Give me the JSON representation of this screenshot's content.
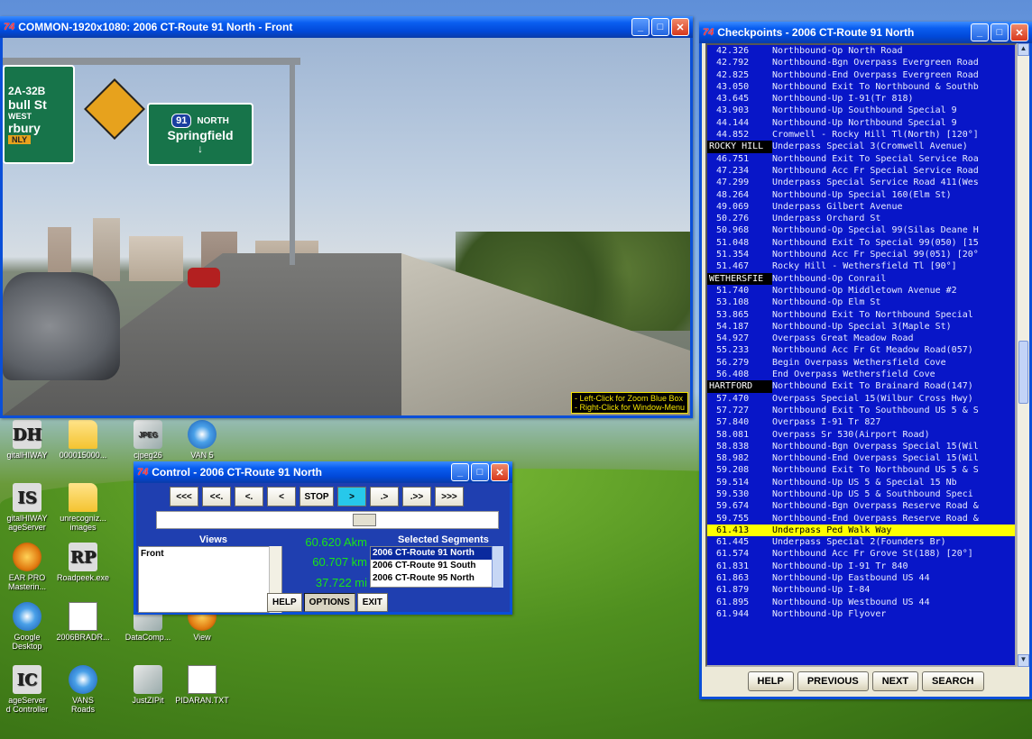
{
  "video_window": {
    "title": "COMMON-1920x1080: 2006 CT-Route 91 North - Front",
    "app_icon": "74",
    "signs": {
      "left_top": "2A-32B",
      "left_line1": "bull St",
      "left_line2": "WEST",
      "left_line3": "rbury",
      "left_line4": "NLY",
      "shield": "91",
      "direction": "NORTH",
      "city": "Springfield"
    },
    "hint_line1": "- Left-Click for Zoom Blue Box",
    "hint_line2": "- Right-Click for Window-Menu"
  },
  "checkpoints_window": {
    "title": "Checkpoints - 2006 CT-Route 91 North",
    "app_icon": "74",
    "rows": [
      {
        "km": "42.326",
        "desc": "Northbound-Op North Road"
      },
      {
        "km": "42.792",
        "desc": "Northbound-Bgn Overpass Evergreen Road"
      },
      {
        "km": "42.825",
        "desc": "Northbound-End Overpass Evergreen Road"
      },
      {
        "km": "43.050",
        "desc": "Northbound Exit To Northbound & Southb"
      },
      {
        "km": "43.645",
        "desc": "Northbound-Up I-91(Tr 818)"
      },
      {
        "km": "43.903",
        "desc": "Northbound-Up Southbound Special 9"
      },
      {
        "km": "44.144",
        "desc": "Northbound-Up Northbound Special 9"
      },
      {
        "km": "44.852",
        "desc": "Cromwell - Rocky Hill Tl(North) [120°]"
      },
      {
        "km": "ROCKY HILL",
        "desc": "Underpass Special 3(Cromwell Avenue)",
        "town": true
      },
      {
        "km": "46.751",
        "desc": "Northbound Exit To Special Service Roa"
      },
      {
        "km": "47.234",
        "desc": "Northbound Acc Fr Special Service Road"
      },
      {
        "km": "47.299",
        "desc": "Underpass Special Service Road 411(Wes"
      },
      {
        "km": "48.264",
        "desc": "Northbound-Up Special 160(Elm St)"
      },
      {
        "km": "49.069",
        "desc": "Underpass Gilbert Avenue"
      },
      {
        "km": "50.276",
        "desc": "Underpass Orchard St"
      },
      {
        "km": "50.968",
        "desc": "Northbound-Op Special 99(Silas Deane H"
      },
      {
        "km": "51.048",
        "desc": "Northbound Exit To Special 99(050) [15"
      },
      {
        "km": "51.354",
        "desc": "Northbound Acc Fr Special 99(051) [20°"
      },
      {
        "km": "51.467",
        "desc": "Rocky Hill - Wethersfield Tl [90°]"
      },
      {
        "km": "WETHERSFIE",
        "desc": "Northbound-Op Conrail",
        "town": true
      },
      {
        "km": "51.740",
        "desc": "Northbound-Op Middletown Avenue #2"
      },
      {
        "km": "53.108",
        "desc": "Northbound-Op Elm St"
      },
      {
        "km": "53.865",
        "desc": "Northbound Exit To Northbound Special"
      },
      {
        "km": "54.187",
        "desc": "Northbound-Up Special 3(Maple St)"
      },
      {
        "km": "54.927",
        "desc": "Overpass Great Meadow Road"
      },
      {
        "km": "55.233",
        "desc": "Northbound Acc Fr Gt Meadow Road(057)"
      },
      {
        "km": "56.279",
        "desc": "Begin Overpass Wethersfield Cove"
      },
      {
        "km": "56.408",
        "desc": "End Overpass Wethersfield Cove"
      },
      {
        "km": "HARTFORD",
        "desc": "Northbound Exit To Brainard Road(147)",
        "town": true
      },
      {
        "km": "57.470",
        "desc": "Overpass Special 15(Wilbur Cross Hwy)"
      },
      {
        "km": "57.727",
        "desc": "Northbound Exit To Southbound US 5 & S"
      },
      {
        "km": "57.840",
        "desc": "Overpass I-91 Tr 827"
      },
      {
        "km": "58.081",
        "desc": "Overpass Sr 530(Airport Road)"
      },
      {
        "km": "58.838",
        "desc": "Northbound-Bgn Overpass Special 15(Wil"
      },
      {
        "km": "58.982",
        "desc": "Northbound-End Overpass Special 15(Wil"
      },
      {
        "km": "59.208",
        "desc": "Northbound Exit To Northbound US 5 & S"
      },
      {
        "km": "59.514",
        "desc": "Northbound-Up US 5 & Special 15 Nb"
      },
      {
        "km": "59.530",
        "desc": "Northbound-Up US 5 &  Southbound Speci"
      },
      {
        "km": "59.674",
        "desc": "Northbound-Bgn Overpass Reserve Road &"
      },
      {
        "km": "59.755",
        "desc": "Northbound-End Overpass Reserve Road &"
      },
      {
        "km": "61.413",
        "desc": "Underpass Ped Walk Way",
        "selected": true
      },
      {
        "km": "61.445",
        "desc": "Underpass Special 2(Founders Br)"
      },
      {
        "km": "61.574",
        "desc": "Northbound Acc Fr Grove St(188) [20°]"
      },
      {
        "km": "61.831",
        "desc": "Northbound-Up I-91 Tr 840"
      },
      {
        "km": "61.863",
        "desc": "Northbound-Up Eastbound US 44"
      },
      {
        "km": "61.879",
        "desc": "Northbound-Up I-84"
      },
      {
        "km": "61.895",
        "desc": "Northbound-Up Westbound US 44"
      },
      {
        "km": "61.944",
        "desc": "Northbound-Up Flyover"
      }
    ],
    "buttons": {
      "help": "HELP",
      "previous": "PREVIOUS",
      "next": "NEXT",
      "search": "SEARCH"
    }
  },
  "control_window": {
    "title": "Control - 2006 CT-Route 91 North",
    "app_icon": "74",
    "play_buttons": [
      "<<<",
      "<<.",
      "<.",
      "<",
      "STOP",
      ">",
      ".>",
      ".>>",
      ">>>"
    ],
    "active_play": ">",
    "slider_position": 0.62,
    "views_label": "Views",
    "views": [
      "Front"
    ],
    "readouts": {
      "akm": "60.620 Akm",
      "km": "60.707 km",
      "mi": "37.722 mi"
    },
    "segments_label": "Selected Segments",
    "segments": [
      "2006 CT-Route 91 North",
      "2006 CT-Route 91 South",
      "2006 CT-Route 95 North"
    ],
    "selected_segment": 0,
    "buttons": {
      "help": "HELP",
      "options": "OPTIONS",
      "exit": "EXIT"
    }
  },
  "desktop_icons": [
    {
      "label": "gitalHIWAY",
      "glyph": "DH"
    },
    {
      "label": "000015000...",
      "glyph": ""
    },
    {
      "label": "cjpeg26",
      "glyph": "JPEG"
    },
    {
      "label": "VAN 5",
      "glyph": ""
    },
    {
      "label": "gitalHIWAY\nageServer",
      "glyph": "IS"
    },
    {
      "label": "unrecogniz...\nimages",
      "glyph": ""
    },
    {
      "label": "EAR PRO\nMasterin...",
      "glyph": ""
    },
    {
      "label": "Roadpeek.exe",
      "glyph": "RP"
    },
    {
      "label": "Google\nDesktop",
      "glyph": ""
    },
    {
      "label": "2006BRADR...",
      "glyph": ""
    },
    {
      "label": "DataComp...",
      "glyph": ""
    },
    {
      "label": "View",
      "glyph": ""
    },
    {
      "label": "ageServer\nd Controller",
      "glyph": "IC"
    },
    {
      "label": "VANS\nRoads",
      "glyph": ""
    },
    {
      "label": "JustZIPit",
      "glyph": ""
    },
    {
      "label": "PIDARAN.TXT",
      "glyph": ""
    }
  ]
}
